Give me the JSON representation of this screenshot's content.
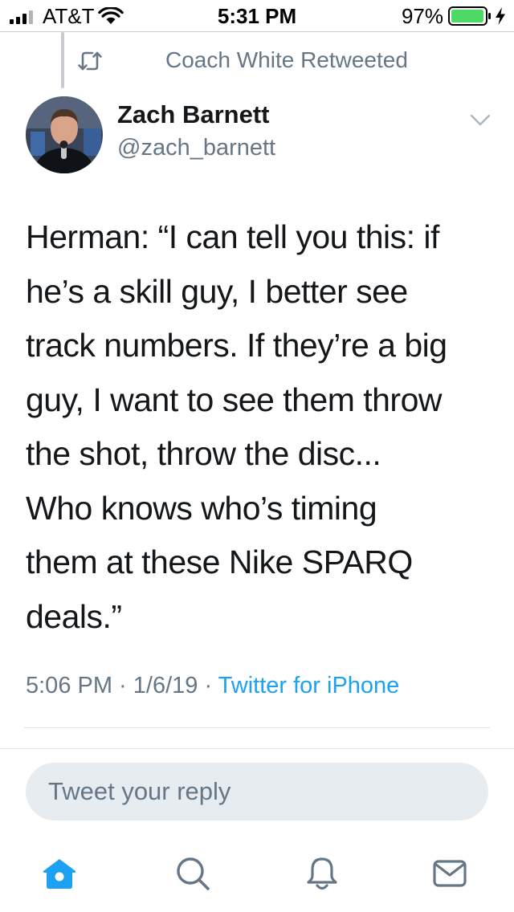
{
  "status_bar": {
    "carrier": "AT&T",
    "time": "5:31 PM",
    "battery": "97%"
  },
  "context": {
    "retweeted_by": "Coach White Retweeted"
  },
  "author": {
    "name": "Zach Barnett",
    "handle": "@zach_barnett"
  },
  "tweet": {
    "text": "Herman: “I can tell you this: if\nhe’s a skill guy, I better see\ntrack numbers. If they’re a big\nguy, I want to see them throw\nthe shot, throw the disc...\nWho knows who’s timing\nthem at these Nike SPARQ\ndeals.”",
    "time_date": "5:06 PM · 1/6/19 · ",
    "source": "Twitter for iPhone"
  },
  "reply": {
    "placeholder": "Tweet your reply"
  },
  "tab_bar": {
    "tabs": [
      {
        "icon": "home-icon",
        "active": true
      },
      {
        "icon": "search-icon",
        "active": false
      },
      {
        "icon": "notifications-icon",
        "active": false
      },
      {
        "icon": "messages-icon",
        "active": false
      }
    ]
  },
  "colors": {
    "accent": "#1da1f2",
    "secondary_text": "#657786",
    "primary_text": "#14171a",
    "battery": "#4cd964",
    "reply_background": "#e6ecf0"
  }
}
